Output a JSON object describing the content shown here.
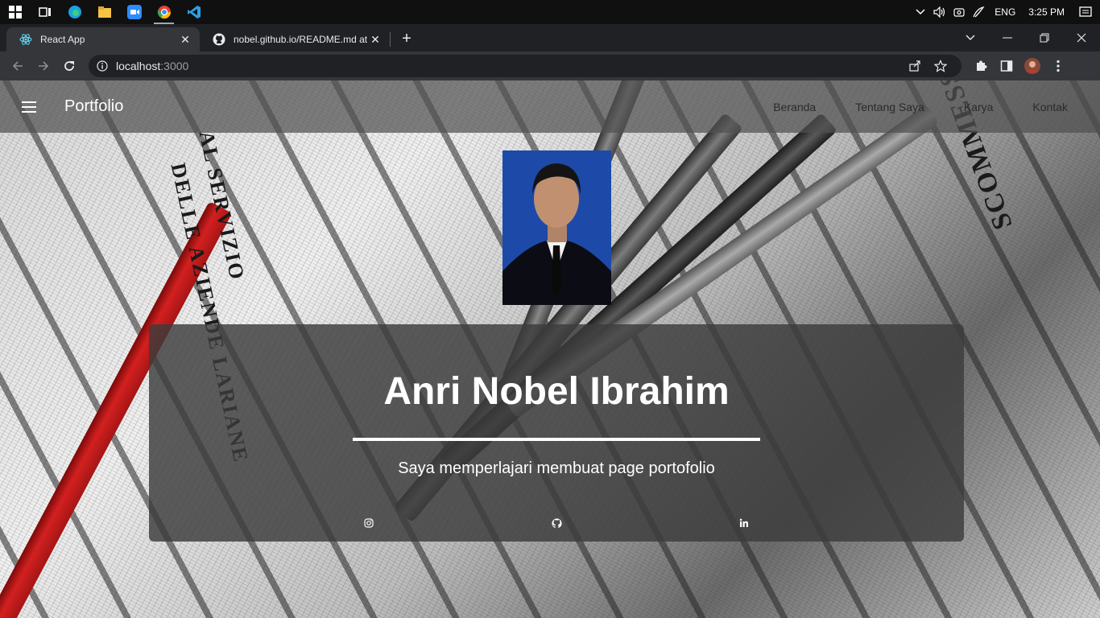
{
  "taskbar": {
    "lang": "ENG",
    "time": "3:25 PM"
  },
  "tabs": [
    {
      "title": "React App",
      "favicon": "react-icon"
    },
    {
      "title": "nobel.github.io/README.md at m",
      "favicon": "github-icon"
    }
  ],
  "address_bar": {
    "host": "localhost",
    "port": ":3000"
  },
  "appbar": {
    "brand": "Portfolio",
    "links": [
      "Beranda",
      "Tentang Saya",
      "Karya",
      "Kontak"
    ]
  },
  "hero": {
    "name": "Anri Nobel Ibrahim",
    "subtitle": "Saya memperlajari membuat page portofolio",
    "social": [
      "instagram-icon",
      "github-icon",
      "linkedin-icon"
    ]
  },
  "background_text": [
    "DELLE AZIENDE LARIANE",
    "AL SERVIZIO",
    "SCOMMESS"
  ]
}
